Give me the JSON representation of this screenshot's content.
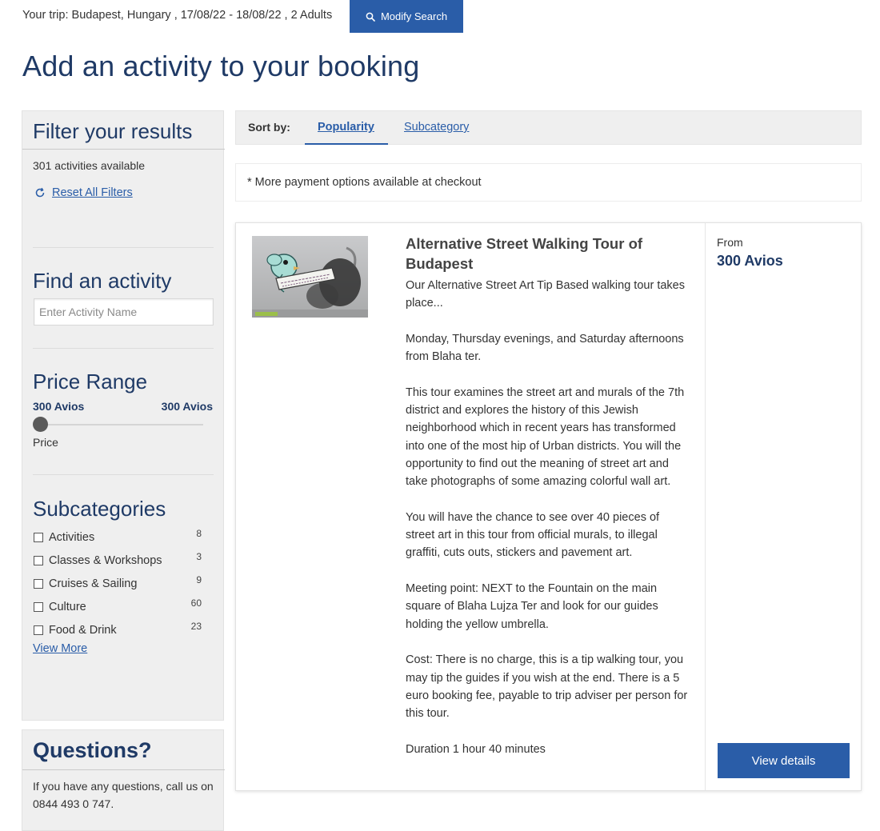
{
  "trip": {
    "summary": "Your trip: Budapest, Hungary , 17/08/22 - 18/08/22 , 2 Adults",
    "modify_label": "Modify Search"
  },
  "page_title": "Add an activity to your booking",
  "sidebar": {
    "filter_title": "Filter your results",
    "count_text": "301 activities available",
    "reset_label": "Reset All Filters",
    "find_title": "Find an activity",
    "find_placeholder": "Enter Activity Name",
    "price_title": "Price Range",
    "price_min": "300 Avios",
    "price_max": "300 Avios",
    "price_label": "Price",
    "price_slider_position": 0,
    "subcategories_title": "Subcategories",
    "subcategories": [
      {
        "label": "Activities",
        "count": "8"
      },
      {
        "label": "Classes & Workshops",
        "count": "3"
      },
      {
        "label": "Cruises & Sailing",
        "count": "9"
      },
      {
        "label": "Culture",
        "count": "60"
      },
      {
        "label": "Food & Drink",
        "count": "23"
      }
    ],
    "view_more_label": "View More"
  },
  "questions": {
    "title": "Questions?",
    "text": "If you have any questions, call us on 0844 493 0 747."
  },
  "sort": {
    "label": "Sort by:",
    "tabs": [
      {
        "label": "Popularity",
        "active": true
      },
      {
        "label": "Subcategory",
        "active": false
      }
    ]
  },
  "payment_note": "* More payment options available at checkout",
  "result": {
    "title": "Alternative Street Walking Tour of Budapest",
    "description": [
      "Our Alternative Street Art Tip Based walking tour takes place...",
      "Monday, Thursday evenings, and Saturday afternoons from Blaha ter.",
      "This tour examines the street art and murals of the 7th district and explores the history of this Jewish neighborhood which in recent years has transformed into one of the most hip of Urban districts. You will the opportunity to find out the meaning of street art and take photographs of some amazing colorful wall art.",
      "You will have the chance to see over 40 pieces of street art in this tour from official murals, to illegal graffiti, cuts outs, stickers and pavement art.",
      "Meeting point: NEXT to the Fountain on the main square of Blaha Lujza Ter and look for our guides holding the yellow umbrella.",
      "Cost: There is no charge, this is a tip walking tour, you may tip the guides if you wish at the end. There is a 5 euro booking fee, payable to trip adviser per person for this tour.",
      "Duration 1 hour 40 minutes"
    ],
    "from_label": "From",
    "price": "300 Avios",
    "cta_label": "View details"
  },
  "colors": {
    "brand_blue": "#2a5da8",
    "heading_navy": "#1f3a66",
    "panel_grey": "#efefef"
  },
  "icons": {
    "modify": "search-icon",
    "reset": "refresh-icon"
  }
}
